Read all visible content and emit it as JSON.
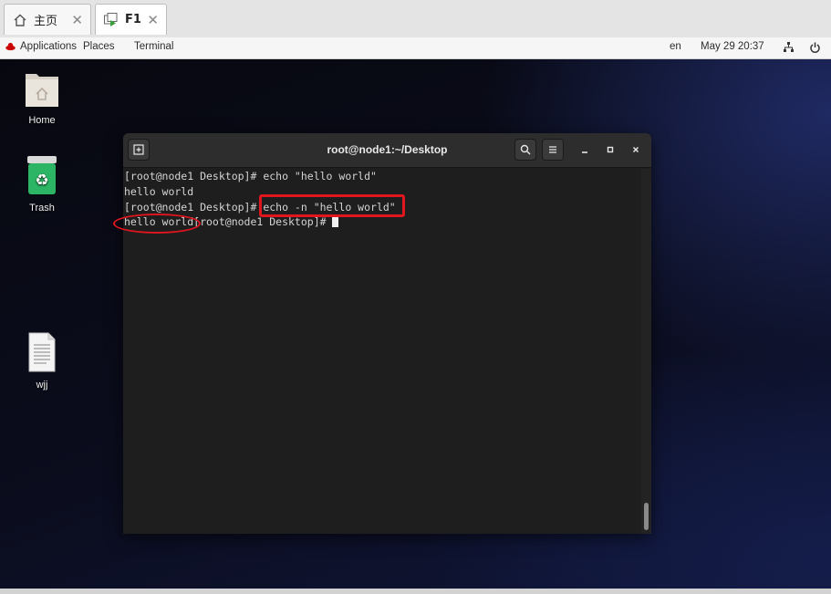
{
  "vm_tabs": [
    {
      "label": "主页",
      "icon": "home-icon"
    },
    {
      "label": "F1",
      "icon": "vm-icon"
    }
  ],
  "topbar": {
    "applications": "Applications",
    "places": "Places",
    "terminal": "Terminal",
    "language": "en",
    "datetime": "May 29  20:37"
  },
  "desktop_icons": [
    {
      "label": "Home",
      "icon": "home-folder-icon"
    },
    {
      "label": "Trash",
      "icon": "trash-icon"
    },
    {
      "label": "wjj",
      "icon": "text-file-icon"
    }
  ],
  "terminal": {
    "title": "root@node1:~/Desktop",
    "lines": [
      "[root@node1 Desktop]# echo \"hello world\"",
      "hello world",
      "[root@node1 Desktop]# echo -n \"hello world\"",
      "hello world[root@node1 Desktop]# "
    ]
  },
  "colors": {
    "annotation": "#e0161f",
    "terminal_bg": "#1e1e1e",
    "header_bg": "#2d2d2d"
  }
}
